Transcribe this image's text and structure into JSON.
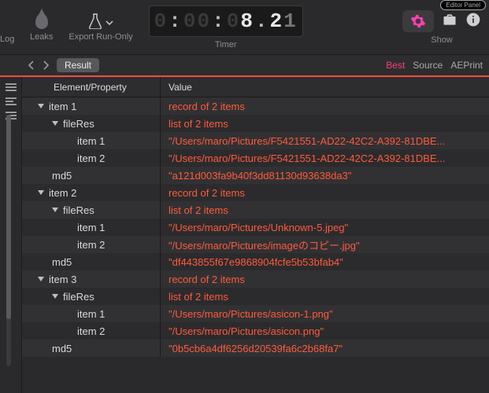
{
  "toolbar": {
    "log_label": "Log",
    "leaks_label": "Leaks",
    "export_label": "Export Run-Only",
    "timer_label": "Timer",
    "show_label": "Show",
    "timer_value": "0:00:08.21",
    "top_right_badge": "Editor Panel"
  },
  "subbar": {
    "result_label": "Result",
    "tabs": {
      "best": "Best",
      "source": "Source",
      "aeprint": "AEPrint"
    }
  },
  "columns": {
    "prop": "Element/Property",
    "val": "Value"
  },
  "rows": [
    {
      "indent": 0,
      "disc": true,
      "prop": "item 1",
      "val": "record of 2 items"
    },
    {
      "indent": 1,
      "disc": true,
      "prop": "fileRes",
      "val": "list of 2 items"
    },
    {
      "indent": 2,
      "disc": false,
      "prop": "item 1",
      "val": "\"/Users/maro/Pictures/F5421551-AD22-42C2-A392-81DBE..."
    },
    {
      "indent": 2,
      "disc": false,
      "prop": "item 2",
      "val": "\"/Users/maro/Pictures/F5421551-AD22-42C2-A392-81DBE..."
    },
    {
      "indent": 1,
      "disc": false,
      "prop": "md5",
      "val": "\"a121d003fa9b40f3dd81130d93638da3\""
    },
    {
      "indent": 0,
      "disc": true,
      "prop": "item 2",
      "val": "record of 2 items"
    },
    {
      "indent": 1,
      "disc": true,
      "prop": "fileRes",
      "val": "list of 2 items"
    },
    {
      "indent": 2,
      "disc": false,
      "prop": "item 1",
      "val": "\"/Users/maro/Pictures/Unknown-5.jpeg\""
    },
    {
      "indent": 2,
      "disc": false,
      "prop": "item 2",
      "val": "\"/Users/maro/Pictures/imageのコピー.jpg\""
    },
    {
      "indent": 1,
      "disc": false,
      "prop": "md5",
      "val": "\"df443855f67e9868904fcfe5b53bfab4\""
    },
    {
      "indent": 0,
      "disc": true,
      "prop": "item 3",
      "val": "record of 2 items"
    },
    {
      "indent": 1,
      "disc": true,
      "prop": "fileRes",
      "val": "list of 2 items"
    },
    {
      "indent": 2,
      "disc": false,
      "prop": "item 1",
      "val": "\"/Users/maro/Pictures/asicon-1.png\""
    },
    {
      "indent": 2,
      "disc": false,
      "prop": "item 2",
      "val": "\"/Users/maro/Pictures/asicon.png\""
    },
    {
      "indent": 1,
      "disc": false,
      "prop": "md5",
      "val": "\"0b5cb6a4df6256d20539fa6c2b68fa7\""
    }
  ]
}
